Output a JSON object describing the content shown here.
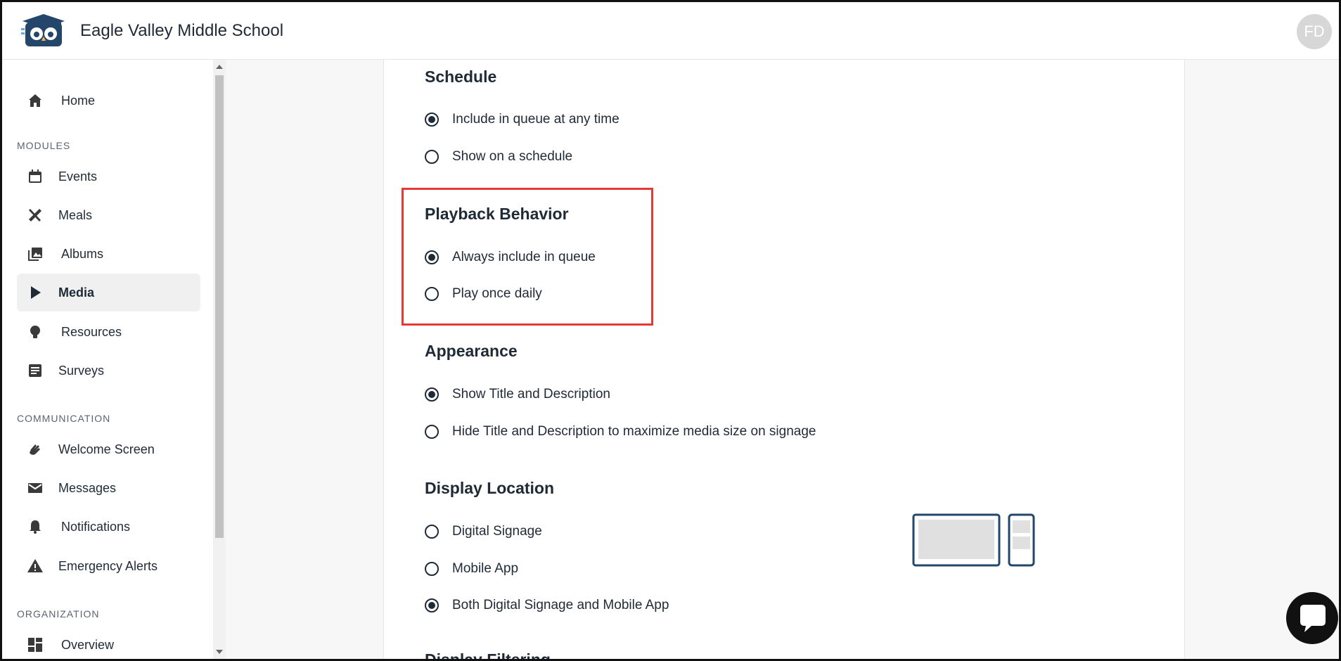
{
  "header": {
    "school_name": "Eagle Valley Middle School",
    "avatar_initials": "FD"
  },
  "sidebar": {
    "home": "Home",
    "modules_label": "MODULES",
    "modules": [
      "Events",
      "Meals",
      "Albums",
      "Media",
      "Resources",
      "Surveys"
    ],
    "communication_label": "COMMUNICATION",
    "communication": [
      "Welcome Screen",
      "Messages",
      "Notifications",
      "Emergency Alerts"
    ],
    "organization_label": "ORGANIZATION",
    "organization": [
      "Overview"
    ],
    "active_item": "Media"
  },
  "settings": {
    "schedule": {
      "title": "Schedule",
      "options": [
        "Include in queue at any time",
        "Show on a schedule"
      ],
      "selected": 0
    },
    "playback": {
      "title": "Playback Behavior",
      "options": [
        "Always include in queue",
        "Play once daily"
      ],
      "selected": 0
    },
    "appearance": {
      "title": "Appearance",
      "options": [
        "Show Title and Description",
        "Hide Title and Description to maximize media size on signage"
      ],
      "selected": 0
    },
    "display_location": {
      "title": "Display Location",
      "options": [
        "Digital Signage",
        "Mobile App",
        "Both Digital Signage and Mobile App"
      ],
      "selected": 2
    },
    "next_section_title": "Display Filtering"
  },
  "colors": {
    "highlight": "#e53935",
    "text": "#1f2a37",
    "active_bg": "#f0f0f0"
  }
}
